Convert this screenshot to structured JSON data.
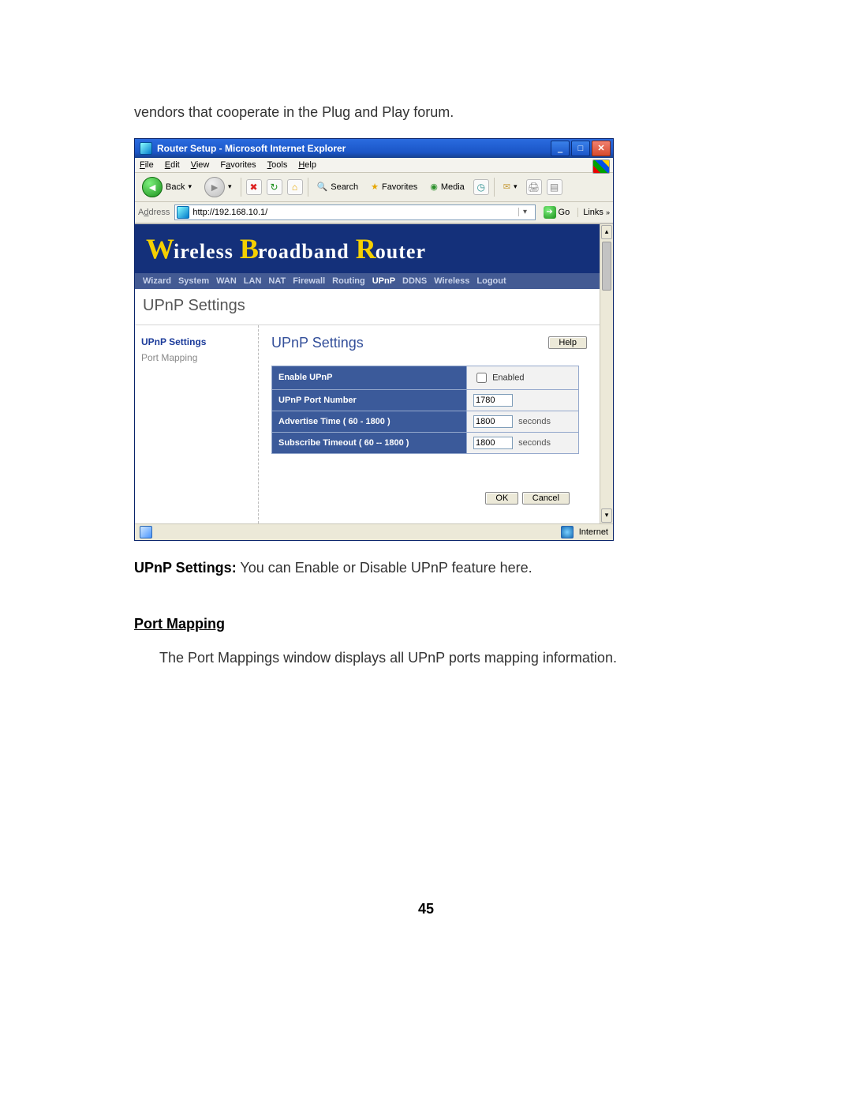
{
  "doc": {
    "intro_fragment": "vendors that cooperate in the Plug and Play forum.",
    "upnp_caption_bold": "UPnP Settings:",
    "upnp_caption_rest": " You can Enable or Disable UPnP feature here.",
    "section_heading": "Port Mapping",
    "section_body": "The Port Mappings window displays all UPnP ports mapping information.",
    "page_number": "45"
  },
  "window": {
    "title": "Router Setup - Microsoft Internet Explorer",
    "menu": {
      "file": "File",
      "edit": "Edit",
      "view": "View",
      "favorites": "Favorites",
      "tools": "Tools",
      "help": "Help"
    },
    "toolbar": {
      "back": "Back",
      "search": "Search",
      "favorites": "Favorites",
      "media": "Media"
    },
    "address_label": "Address",
    "url": "http://192.168.10.1/",
    "go": "Go",
    "links": "Links",
    "status_right": "Internet"
  },
  "router": {
    "brand": {
      "w": "W",
      "w_rest": "ireless",
      "b": "B",
      "b_rest": "roadband",
      "r": "R",
      "r_rest": "outer"
    },
    "tabs": [
      "Wizard",
      "System",
      "WAN",
      "LAN",
      "NAT",
      "Firewall",
      "Routing",
      "UPnP",
      "DDNS",
      "Wireless",
      "Logout"
    ],
    "active_tab": "UPnP",
    "page_title": "UPnP Settings",
    "sidebar": {
      "item1": "UPnP Settings",
      "item2": "Port Mapping"
    },
    "panel_title": "UPnP Settings",
    "help": "Help",
    "rows": {
      "enable_label": "Enable UPnP",
      "enable_text": "Enabled",
      "enable_checked": false,
      "port_label": "UPnP Port Number",
      "port_value": "1780",
      "adv_label": "Advertise Time ( 60 - 1800 )",
      "adv_value": "1800",
      "adv_unit": "seconds",
      "sub_label": "Subscribe Timeout ( 60 -- 1800 )",
      "sub_value": "1800",
      "sub_unit": "seconds"
    },
    "ok": "OK",
    "cancel": "Cancel"
  }
}
